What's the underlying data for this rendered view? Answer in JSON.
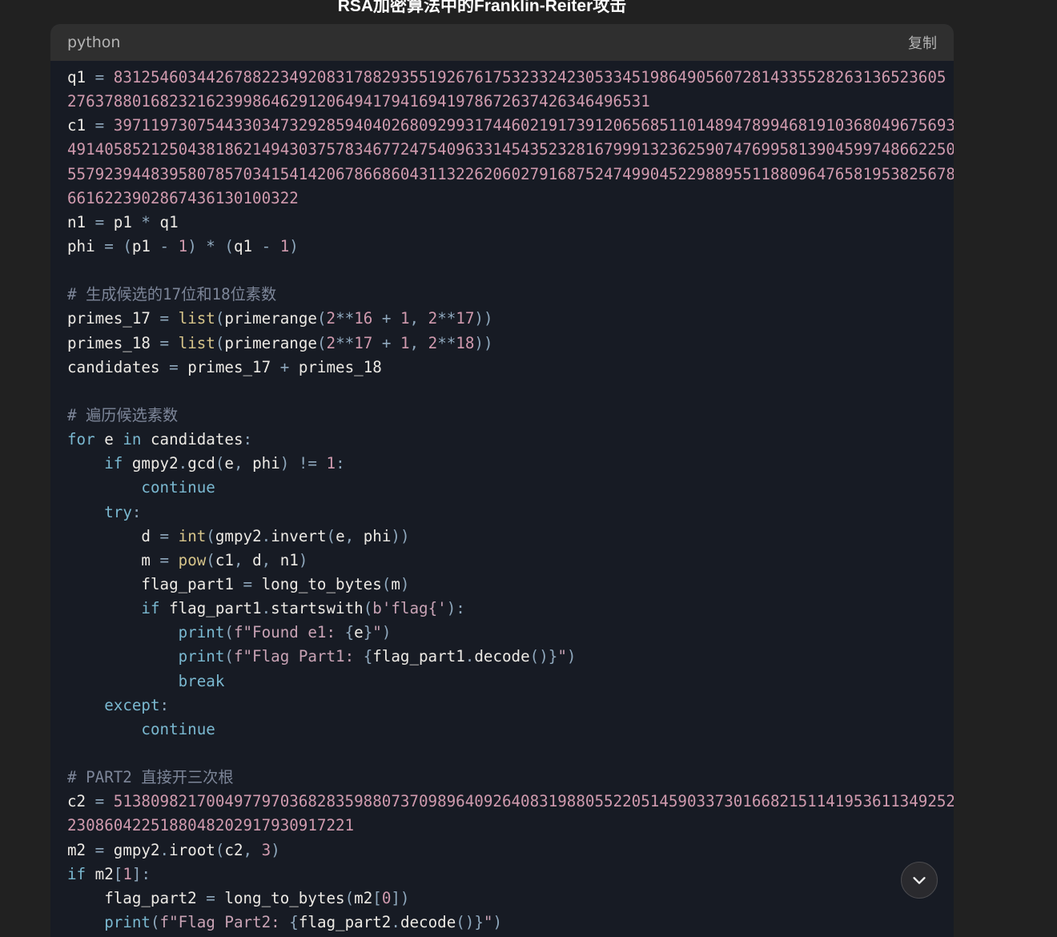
{
  "page": {
    "title": "RSA加密算法中的Franklin-Reiter攻击"
  },
  "code_block": {
    "language": "python",
    "copy_label": "复制",
    "lines": [
      [
        [
          "plain",
          "q1 "
        ],
        [
          "op",
          "= "
        ],
        [
          "num",
          "831254603442678822349208317882935519267617532332423053345198649056072814335528263136523605"
        ]
      ],
      [
        [
          "num",
          "2763788016823216239986462912064941794169419786726374263464965 31"
        ]
      ],
      [
        [
          "plain",
          "c1 "
        ],
        [
          "op",
          "= "
        ],
        [
          "num",
          "397119730754433034732928594040268092993174460219173912065685110148947899468191036804967569 3"
        ]
      ],
      [
        [
          "num",
          "491405852125043818621494303757834677247540963314543523281679991323625907476995813904599748662250"
        ]
      ],
      [
        [
          "num",
          "557923944839580785703415414206786686043113226206027916875247499045229889551188096476581953825678"
        ]
      ],
      [
        [
          "num",
          "6616223902867436130100322"
        ]
      ],
      [
        [
          "plain",
          "n1 "
        ],
        [
          "op",
          "= "
        ],
        [
          "plain",
          "p1 "
        ],
        [
          "op",
          "* "
        ],
        [
          "plain",
          "q1"
        ]
      ],
      [
        [
          "plain",
          "phi "
        ],
        [
          "op",
          "= ("
        ],
        [
          "plain",
          "p1 "
        ],
        [
          "op",
          "- "
        ],
        [
          "num",
          "1"
        ],
        [
          "op",
          ") * ("
        ],
        [
          "plain",
          "q1 "
        ],
        [
          "op",
          "- "
        ],
        [
          "num",
          "1"
        ],
        [
          "op",
          ")"
        ]
      ],
      [],
      [
        [
          "comment",
          "# 生成候选的17位和18位素数"
        ]
      ],
      [
        [
          "plain",
          "primes_17 "
        ],
        [
          "op",
          "= "
        ],
        [
          "builtin",
          "list"
        ],
        [
          "op",
          "("
        ],
        [
          "plain",
          "primerange"
        ],
        [
          "op",
          "("
        ],
        [
          "num",
          "2"
        ],
        [
          "op",
          "**"
        ],
        [
          "num",
          "16 "
        ],
        [
          "op",
          "+ "
        ],
        [
          "num",
          "1"
        ],
        [
          "op",
          ", "
        ],
        [
          "num",
          "2"
        ],
        [
          "op",
          "**"
        ],
        [
          "num",
          "17"
        ],
        [
          "op",
          "))"
        ]
      ],
      [
        [
          "plain",
          "primes_18 "
        ],
        [
          "op",
          "= "
        ],
        [
          "builtin",
          "list"
        ],
        [
          "op",
          "("
        ],
        [
          "plain",
          "primerange"
        ],
        [
          "op",
          "("
        ],
        [
          "num",
          "2"
        ],
        [
          "op",
          "**"
        ],
        [
          "num",
          "17 "
        ],
        [
          "op",
          "+ "
        ],
        [
          "num",
          "1"
        ],
        [
          "op",
          ", "
        ],
        [
          "num",
          "2"
        ],
        [
          "op",
          "**"
        ],
        [
          "num",
          "18"
        ],
        [
          "op",
          "))"
        ]
      ],
      [
        [
          "plain",
          "candidates "
        ],
        [
          "op",
          "= "
        ],
        [
          "plain",
          "primes_17 "
        ],
        [
          "op",
          "+ "
        ],
        [
          "plain",
          "primes_18"
        ]
      ],
      [],
      [
        [
          "comment",
          "# 遍历候选素数"
        ]
      ],
      [
        [
          "kw",
          "for "
        ],
        [
          "plain",
          "e "
        ],
        [
          "kw",
          "in "
        ],
        [
          "plain",
          "candidates"
        ],
        [
          "op",
          ":"
        ]
      ],
      [
        [
          "plain",
          "    "
        ],
        [
          "kw",
          "if "
        ],
        [
          "plain",
          "gmpy2"
        ],
        [
          "op",
          "."
        ],
        [
          "plain",
          "gcd"
        ],
        [
          "op",
          "("
        ],
        [
          "plain",
          "e"
        ],
        [
          "op",
          ", "
        ],
        [
          "plain",
          "phi"
        ],
        [
          "op",
          ") != "
        ],
        [
          "num",
          "1"
        ],
        [
          "op",
          ":"
        ]
      ],
      [
        [
          "plain",
          "        "
        ],
        [
          "kw",
          "continue"
        ]
      ],
      [
        [
          "plain",
          "    "
        ],
        [
          "kw",
          "try"
        ],
        [
          "op",
          ":"
        ]
      ],
      [
        [
          "plain",
          "        d "
        ],
        [
          "op",
          "= "
        ],
        [
          "builtin",
          "int"
        ],
        [
          "op",
          "("
        ],
        [
          "plain",
          "gmpy2"
        ],
        [
          "op",
          "."
        ],
        [
          "plain",
          "invert"
        ],
        [
          "op",
          "("
        ],
        [
          "plain",
          "e"
        ],
        [
          "op",
          ", "
        ],
        [
          "plain",
          "phi"
        ],
        [
          "op",
          "))"
        ]
      ],
      [
        [
          "plain",
          "        m "
        ],
        [
          "op",
          "= "
        ],
        [
          "builtin",
          "pow"
        ],
        [
          "op",
          "("
        ],
        [
          "plain",
          "c1"
        ],
        [
          "op",
          ", "
        ],
        [
          "plain",
          "d"
        ],
        [
          "op",
          ", "
        ],
        [
          "plain",
          "n1"
        ],
        [
          "op",
          ")"
        ]
      ],
      [
        [
          "plain",
          "        flag_part1 "
        ],
        [
          "op",
          "= "
        ],
        [
          "plain",
          "long_to_bytes"
        ],
        [
          "op",
          "("
        ],
        [
          "plain",
          "m"
        ],
        [
          "op",
          ")"
        ]
      ],
      [
        [
          "plain",
          "        "
        ],
        [
          "kw",
          "if "
        ],
        [
          "plain",
          "flag_part1"
        ],
        [
          "op",
          "."
        ],
        [
          "plain",
          "startswith"
        ],
        [
          "op",
          "("
        ],
        [
          "str",
          "b'flag{'"
        ],
        [
          "op",
          "):"
        ]
      ],
      [
        [
          "plain",
          "            "
        ],
        [
          "kw",
          "print"
        ],
        [
          "op",
          "("
        ],
        [
          "str",
          "f\"Found e1: "
        ],
        [
          "op",
          "{"
        ],
        [
          "plain",
          "e"
        ],
        [
          "op",
          "}"
        ],
        [
          "str",
          "\""
        ],
        [
          "op",
          ")"
        ]
      ],
      [
        [
          "plain",
          "            "
        ],
        [
          "kw",
          "print"
        ],
        [
          "op",
          "("
        ],
        [
          "str",
          "f\"Flag Part1: "
        ],
        [
          "op",
          "{"
        ],
        [
          "plain",
          "flag_part1"
        ],
        [
          "op",
          "."
        ],
        [
          "plain",
          "decode"
        ],
        [
          "op",
          "()}"
        ],
        [
          "str",
          "\""
        ],
        [
          "op",
          ")"
        ]
      ],
      [
        [
          "plain",
          "            "
        ],
        [
          "kw",
          "break"
        ]
      ],
      [
        [
          "plain",
          "    "
        ],
        [
          "kw",
          "except"
        ],
        [
          "op",
          ":"
        ]
      ],
      [
        [
          "plain",
          "        "
        ],
        [
          "kw",
          "continue"
        ]
      ],
      [],
      [
        [
          "comment",
          "# PART2 直接开三次根"
        ]
      ],
      [
        [
          "plain",
          "c2 "
        ],
        [
          "op",
          "= "
        ],
        [
          "num",
          "513809821700497797036828359880737098964092640831988055220514590337301668215114195361134925 2"
        ]
      ],
      [
        [
          "num",
          "2308604225188048202917930917221"
        ]
      ],
      [
        [
          "plain",
          "m2 "
        ],
        [
          "op",
          "= "
        ],
        [
          "plain",
          "gmpy2"
        ],
        [
          "op",
          "."
        ],
        [
          "plain",
          "iroot"
        ],
        [
          "op",
          "("
        ],
        [
          "plain",
          "c2"
        ],
        [
          "op",
          ", "
        ],
        [
          "num",
          "3"
        ],
        [
          "op",
          ")"
        ]
      ],
      [
        [
          "kw",
          "if "
        ],
        [
          "plain",
          "m2"
        ],
        [
          "op",
          "["
        ],
        [
          "num",
          "1"
        ],
        [
          "op",
          "]:"
        ]
      ],
      [
        [
          "plain",
          "    flag_part2 "
        ],
        [
          "op",
          "= "
        ],
        [
          "plain",
          "long_to_bytes"
        ],
        [
          "op",
          "("
        ],
        [
          "plain",
          "m2"
        ],
        [
          "op",
          "["
        ],
        [
          "num",
          "0"
        ],
        [
          "op",
          "])"
        ]
      ],
      [
        [
          "plain",
          "    "
        ],
        [
          "kw",
          "print"
        ],
        [
          "op",
          "("
        ],
        [
          "str",
          "f\"Flag Part2: "
        ],
        [
          "op",
          "{"
        ],
        [
          "plain",
          "flag_part2"
        ],
        [
          "op",
          "."
        ],
        [
          "plain",
          "decode"
        ],
        [
          "op",
          "()}"
        ],
        [
          "str",
          "\""
        ],
        [
          "op",
          ")"
        ]
      ]
    ]
  },
  "scroll_button": {
    "icon": "chevron-down-icon"
  }
}
